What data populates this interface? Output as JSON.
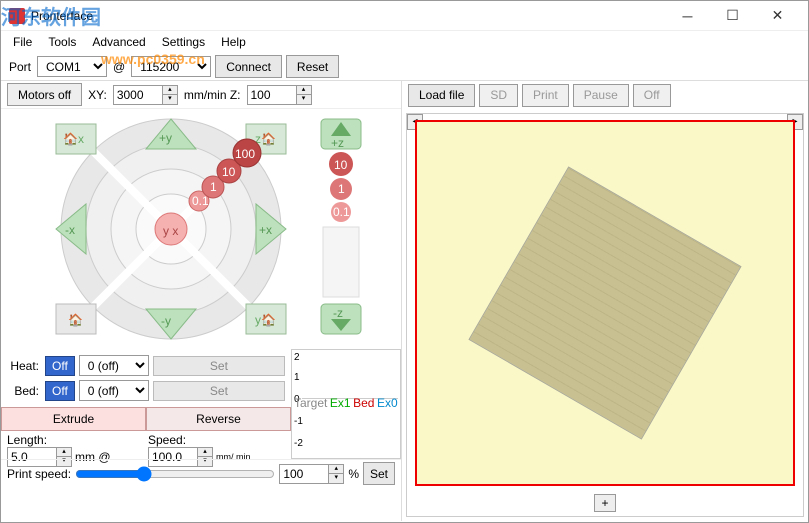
{
  "window": {
    "title": "Pronterface"
  },
  "menu": {
    "file": "File",
    "tools": "Tools",
    "advanced": "Advanced",
    "settings": "Settings",
    "help": "Help"
  },
  "watermark": {
    "t1": "河东软件园",
    "t2": "www.pc0359.cn"
  },
  "toolbar": {
    "port": "Port",
    "port_val": "COM1",
    "baud": "@",
    "baud_val": "115200",
    "connect": "Connect",
    "reset": "Reset"
  },
  "rtbar": {
    "load": "Load file",
    "sd": "SD",
    "print": "Print",
    "pause": "Pause",
    "off": "Off"
  },
  "jog": {
    "motors_off": "Motors off",
    "xy": "XY:",
    "xy_val": "3000",
    "mmmin": "mm/min Z:",
    "z_val": "100",
    "hx": "x",
    "py": "+y",
    "zh": "z",
    "pz": "+z",
    "mx": "-x",
    "px": "+x",
    "my": "-y",
    "yh": "y",
    "mz": "-z",
    "d100": "100",
    "d10": "10",
    "d1": "1",
    "d01": "0.1",
    "yx": "y x"
  },
  "heat": {
    "heat": "Heat:",
    "bed": "Bed:",
    "off": "Off",
    "val": "0 (off)",
    "set": "Set"
  },
  "extrude": {
    "ex": "Extrude",
    "rev": "Reverse",
    "length": "Length:",
    "len_val": "5.0",
    "mm_at": "mm @",
    "speed": "Speed:",
    "speed_val": "100.0",
    "mmmin": "mm/\nmin"
  },
  "printspeed": {
    "label": "Print speed:",
    "val": "100",
    "pct": "%",
    "set": "Set"
  },
  "graph": {
    "y2": "2",
    "y1": "1",
    "y0": "0",
    "ym1": "-1",
    "ym2": "-2",
    "target": "Target",
    "ex1": "Ex1",
    "bed": "Bed",
    "ex0": "Ex0"
  },
  "viewer": {
    "plus": "+"
  }
}
